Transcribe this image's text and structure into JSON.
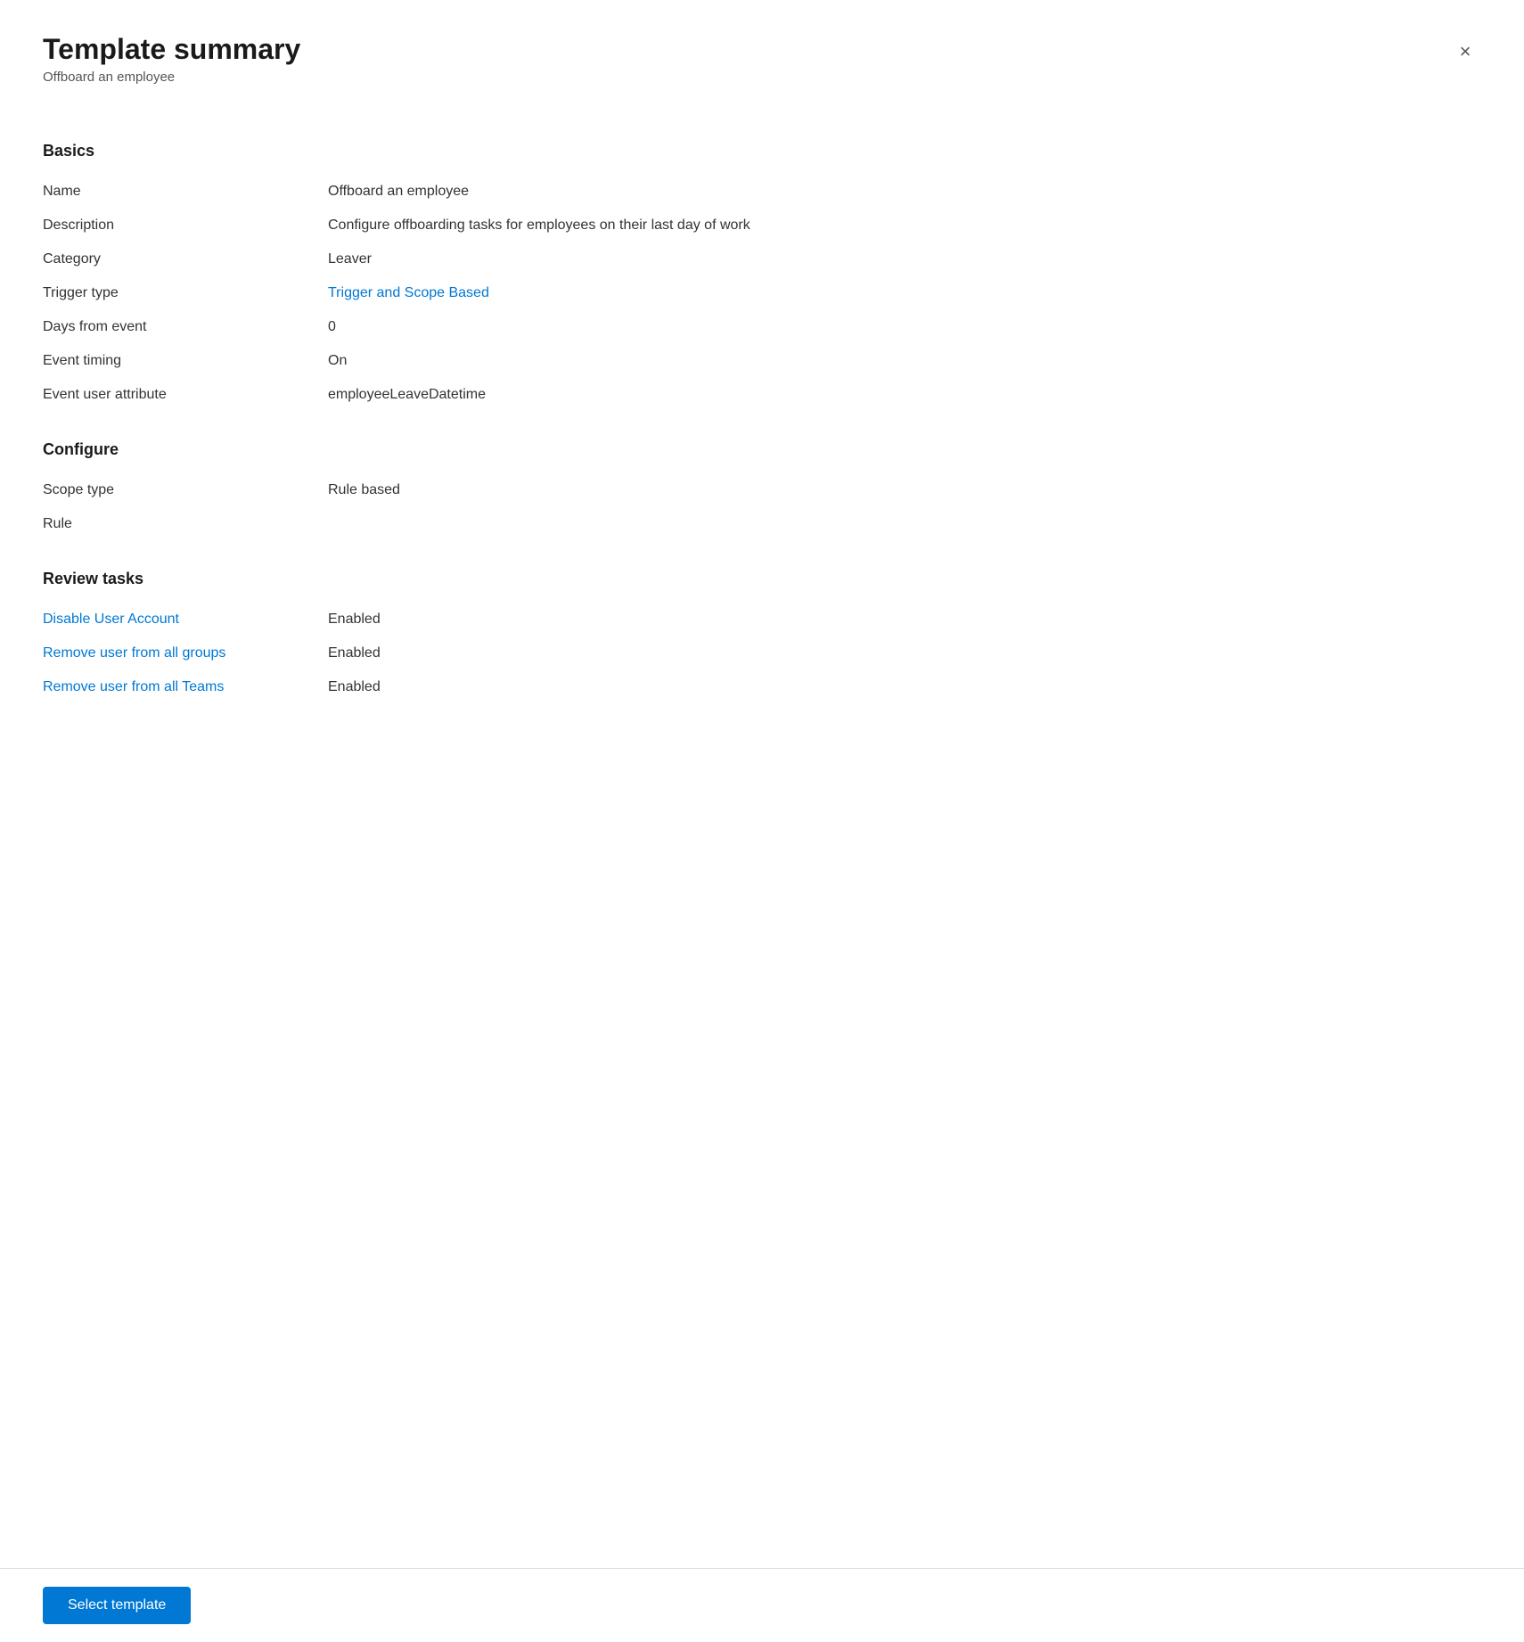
{
  "panel": {
    "title": "Template summary",
    "subtitle": "Offboard an employee",
    "close_label": "×"
  },
  "sections": {
    "basics": {
      "label": "Basics",
      "fields": [
        {
          "label": "Name",
          "value": "Offboard an employee",
          "style": "normal"
        },
        {
          "label": "Description",
          "value": "Configure offboarding tasks for employees on their last day of work",
          "style": "normal"
        },
        {
          "label": "Category",
          "value": "Leaver",
          "style": "normal"
        },
        {
          "label": "Trigger type",
          "value": "Trigger and Scope Based",
          "style": "link"
        },
        {
          "label": "Days from event",
          "value": "0",
          "style": "normal"
        },
        {
          "label": "Event timing",
          "value": "On",
          "style": "normal"
        },
        {
          "label": "Event user attribute",
          "value": "employeeLeaveDatetime",
          "style": "normal"
        }
      ]
    },
    "configure": {
      "label": "Configure",
      "fields": [
        {
          "label": "Scope type",
          "value": "Rule based",
          "style": "normal"
        },
        {
          "label": "Rule",
          "value": "",
          "style": "normal"
        }
      ]
    },
    "review_tasks": {
      "label": "Review tasks",
      "fields": [
        {
          "label": "Disable User Account",
          "value": "Enabled",
          "style": "link"
        },
        {
          "label": "Remove user from all groups",
          "value": "Enabled",
          "style": "link"
        },
        {
          "label": "Remove user from all Teams",
          "value": "Enabled",
          "style": "link"
        }
      ]
    }
  },
  "footer": {
    "select_template_label": "Select template"
  }
}
